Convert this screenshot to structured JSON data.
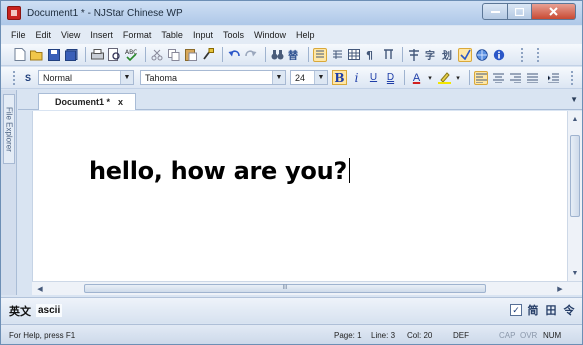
{
  "window": {
    "title": "Document1 * - NJStar Chinese WP"
  },
  "menu": [
    "File",
    "Edit",
    "View",
    "Insert",
    "Format",
    "Table",
    "Input",
    "Tools",
    "Window",
    "Help"
  ],
  "toolbar2": {
    "style_value": "Normal",
    "font_value": "Tahoma",
    "size_value": "24",
    "bold_label": "B",
    "italic_label": "i",
    "underline_label": "U",
    "double_underline_label": "D",
    "font_color_label": "A"
  },
  "side_panel": {
    "label": "File Explorer"
  },
  "tab": {
    "label": "Document1 *",
    "close": "x"
  },
  "document": {
    "text": "hello, how are you?"
  },
  "scroll": {
    "h_thumb_label": "III"
  },
  "input_bar": {
    "language": "英文",
    "mode": "ascii",
    "check": "✓",
    "simplified": "简",
    "grid": "田",
    "tool": "令"
  },
  "status": {
    "help": "For Help, press F1",
    "page": "Page: 1",
    "line": "Line: 3",
    "col": "Col: 20",
    "def": "DEF",
    "cap": "CAP",
    "ovr": "OVR",
    "num": "NUM"
  },
  "colors": {
    "title_bar": "#aec8e8",
    "close_button": "#c84a33",
    "window_bg": "#d9e4f2"
  }
}
